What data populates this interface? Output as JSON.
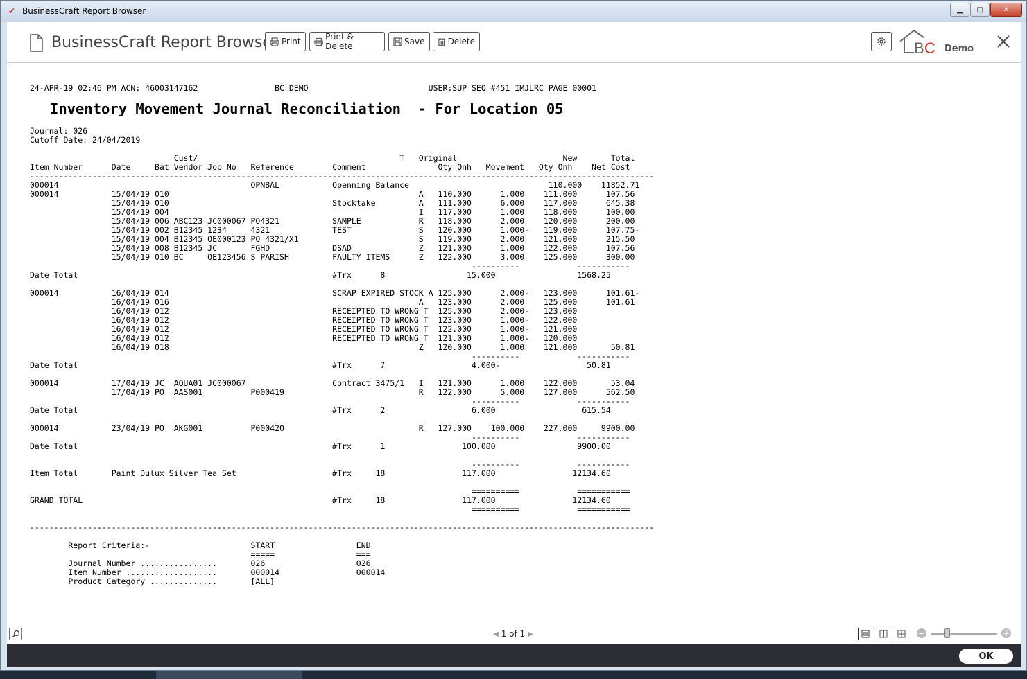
{
  "window": {
    "title": "BusinessCraft Report Browser",
    "minimize_glyph": "▁",
    "maximize_glyph": "□",
    "close_glyph": "✕"
  },
  "toolbar": {
    "app_title": "BusinessCraft Report Browser",
    "print_label": "Print",
    "print_delete_label": "Print & Delete",
    "save_label": "Save",
    "delete_label": "Delete",
    "logo_text": "BC",
    "demo_label": "Demo"
  },
  "report": {
    "header_line": "24-APR-19 02:46 PM ACN: 46003147162                BC DEMO                         USER:SUP SEQ #451 IMJLRC PAGE 00001",
    "title": "Inventory Movement Journal Reconciliation  - For Location 05",
    "body": "Journal: 026\nCutoff Date: 24/04/2019\n\n                              Cust/                                          T   Original                      New       Total\nItem Number      Date     Bat Vendor Job No   Reference        Comment               Qty Onh   Movement   Qty Onh    Net Cost\n----------------------------------------------------------------------------------------------------------------------------------\n000014                                        OPNBAL           Openning Balance                             110.000    11852.71\n000014           15/04/19 010                                                    A   110.000      1.000    111.000      107.56\n                 15/04/19 010                                  Stocktake         A   111.000      6.000    117.000      645.38\n                 15/04/19 004                                                    I   117.000      1.000    118.000      100.00\n                 15/04/19 006 ABC123 JC000067 PO4321           SAMPLE            R   118.000      2.000    120.000      200.00\n                 15/04/19 002 B12345 1234     4321             TEST              S   120.000      1.000-   119.000      107.75-\n                 15/04/19 004 B12345 OE000123 PO 4321/X1                         S   119.000      2.000    121.000      215.50\n                 15/04/19 008 B12345 JC       FGHD             DSAD              Z   121.000      1.000    122.000      107.56\n                 15/04/19 010 BC     OE123456 S PARISH         FAULTY ITEMS      Z   122.000      3.000    125.000      300.00\n                                                                                            ----------            -----------\nDate Total                                                     #Trx      8                 15.000                 1568.25\n\n000014           16/04/19 014                                  SCRAP EXPIRED STOCK A 125.000      2.000-   123.000      101.61-\n                 16/04/19 016                                                    A   123.000      2.000    125.000      101.61\n                 16/04/19 012                                  RECEIPTED TO WRONG T  125.000      2.000-   123.000\n                 16/04/19 012                                  RECEIPTED TO WRONG T  123.000      1.000-   122.000\n                 16/04/19 012                                  RECEIPTED TO WRONG T  122.000      1.000-   121.000\n                 16/04/19 012                                  RECEIPTED TO WRONG T  121.000      1.000-   120.000\n                 16/04/19 018                                                    Z   120.000      1.000    121.000       50.81\n                                                                                            ----------            -----------\nDate Total                                                     #Trx      7                  4.000-                  50.81\n\n000014           17/04/19 JC  AQUA01 JC000067                  Contract 3475/1   I   121.000      1.000    122.000       53.04\n                 17/04/19 PO  AAS001          P000419                            R   122.000      5.000    127.000      562.50\n                                                                                            ----------            -----------\nDate Total                                                     #Trx      2                  6.000                  615.54\n\n000014           23/04/19 PO  AKG001          P000420                            R   127.000    100.000    227.000     9900.00\n                                                                                            ----------            -----------\nDate Total                                                     #Trx      1                100.000                 9900.00\n\n                                                                                            ----------            -----------\nItem Total       Paint Dulux Silver Tea Set                    #Trx     18                117.000                12134.60\n\n                                                                                            ==========            ===========\nGRAND TOTAL                                                    #Trx     18                117.000                12134.60\n                                                                                            ==========            ===========\n\n----------------------------------------------------------------------------------------------------------------------------------\n\n        Report Criteria:-                     START                 END\n                                              =====                 ===\n        Journal Number ................       026                   026\n        Item Number ...................       000014                000014\n        Product Category ..............       [ALL]"
  },
  "statusbar": {
    "page_text": "1 of 1",
    "prev_glyph": "◀",
    "next_glyph": "▶",
    "zoom_minus": "−",
    "zoom_plus": "+"
  },
  "footer": {
    "ok_label": "OK"
  },
  "colors": {
    "footer_bg": "#2c2e33",
    "title_bar": "#d9e4f1",
    "close_button": "#c7432c",
    "logo_red": "#d0312d"
  }
}
